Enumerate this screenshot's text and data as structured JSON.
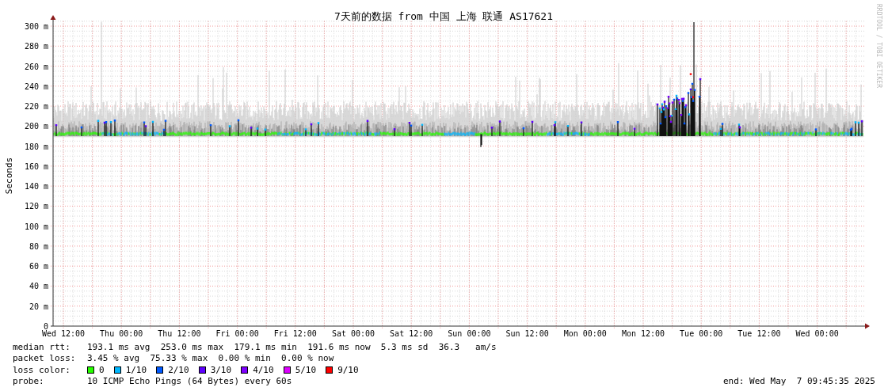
{
  "graph": {
    "title": "7天前的数据 from 中国 上海 联通 AS17621",
    "y_axis_label": "Seconds",
    "credit": "RRDTOOL / TOBI OETIKER",
    "y_ticks": [
      "300 m",
      "280 m",
      "260 m",
      "240 m",
      "220 m",
      "200 m",
      "180 m",
      "160 m",
      "140 m",
      "120 m",
      "100 m",
      "80 m",
      "60 m",
      "40 m",
      "20 m",
      "0"
    ],
    "x_ticks": [
      "Wed 12:00",
      "Thu 00:00",
      "Thu 12:00",
      "Fri 00:00",
      "Fri 12:00",
      "Sat 00:00",
      "Sat 12:00",
      "Sun 00:00",
      "Sun 12:00",
      "Mon 00:00",
      "Mon 12:00",
      "Tue 00:00",
      "Tue 12:00",
      "Wed 00:00"
    ]
  },
  "legend": {
    "median_rtt": {
      "label": "median rtt:",
      "text": "193.1 ms avg  253.0 ms max  179.1 ms min  191.6 ms now  5.3 ms sd  36.3   am/s"
    },
    "packet_loss": {
      "label": "packet loss:",
      "text": "3.45 % avg  75.33 % max  0.00 % min  0.00 % now"
    },
    "loss_color": {
      "label": "loss color:",
      "items": [
        {
          "label": "0",
          "color": "#26ff00"
        },
        {
          "label": "1/10",
          "color": "#00b8ff"
        },
        {
          "label": "2/10",
          "color": "#0059ff"
        },
        {
          "label": "3/10",
          "color": "#5e00ff"
        },
        {
          "label": "4/10",
          "color": "#7e00ff"
        },
        {
          "label": "5/10",
          "color": "#dd00ff"
        },
        {
          "label": "9/10",
          "color": "#ff0000"
        }
      ]
    },
    "probe": {
      "label": "probe:",
      "text": "10 ICMP Echo Pings (64 Bytes) every 60s"
    },
    "end": "end: Wed May  7 09:45:35 2025"
  }
}
